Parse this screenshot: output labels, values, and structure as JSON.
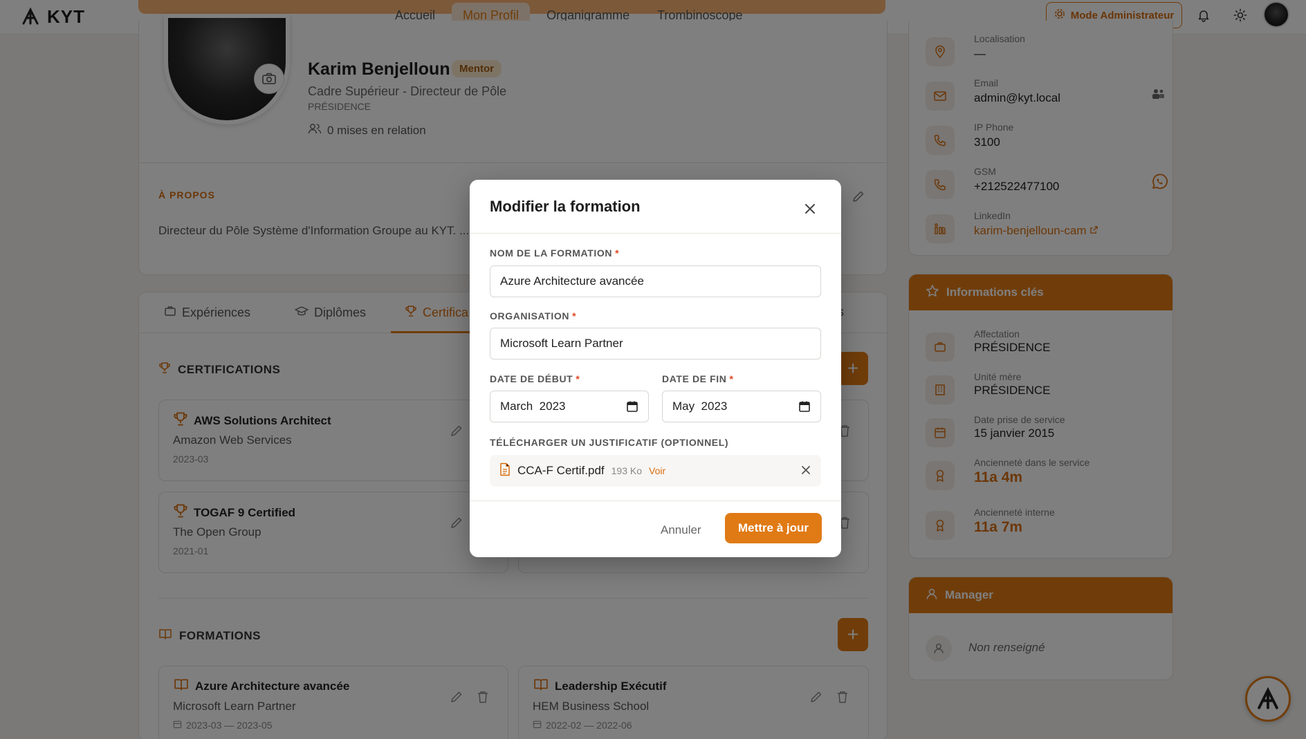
{
  "app": {
    "logo_text": "KYT"
  },
  "nav": {
    "items": [
      "Accueil",
      "Mon Profil",
      "Organigramme",
      "Trombinoscope"
    ],
    "active": "Mon Profil"
  },
  "header": {
    "admin_button": "Mode Administrateur",
    "icons": [
      "bell-icon",
      "sun-icon"
    ]
  },
  "profile": {
    "name": "Karim Benjelloun",
    "badge": "Mentor",
    "title": "Cadre Supérieur - Directeur de Pôle",
    "department": "PRÉSIDENCE",
    "relations": "0 mises en relation",
    "about_heading": "À PROPOS",
    "about_text": "Directeur du Pôle Système d'Information Groupe au KYT. ... et la gouvernance IT, il pilote la modernisation du SI et l'adopt..."
  },
  "tabs": {
    "items": [
      "Expériences",
      "Diplômes",
      "Certifica"
    ],
    "active": "Certifica",
    "trailing": "és"
  },
  "certifications": {
    "heading": "CERTIFICATIONS",
    "items": [
      {
        "title": "AWS Solutions Architect",
        "org": "Amazon Web Services",
        "date": "2023-03"
      },
      {
        "title": "TOGAF 9 Certified",
        "org": "The Open Group",
        "date": "2021-01"
      }
    ]
  },
  "formations": {
    "heading": "FORMATIONS",
    "items": [
      {
        "title": "Azure Architecture avancée",
        "org": "Microsoft Learn Partner",
        "date": "2023-03 — 2023-05"
      },
      {
        "title": "Leadership Exécutif",
        "org": "HEM Business School",
        "date": "2022-02 — 2022-06"
      }
    ]
  },
  "contact": {
    "items": [
      {
        "label": "Localisation",
        "value": "—"
      },
      {
        "label": "Email",
        "value": "admin@kyt.local"
      },
      {
        "label": "IP Phone",
        "value": "3100"
      },
      {
        "label": "GSM",
        "value": "+212522477100"
      },
      {
        "label": "LinkedIn",
        "value": "karim-benjelloun-cam"
      }
    ]
  },
  "key_info": {
    "heading": "Informations clés",
    "items": [
      {
        "label": "Affectation",
        "value": "PRÉSIDENCE"
      },
      {
        "label": "Unité mère",
        "value": "PRÉSIDENCE"
      },
      {
        "label": "Date prise de service",
        "value": "15 janvier 2015"
      },
      {
        "label": "Ancienneté dans le service",
        "value": "11a 4m"
      },
      {
        "label": "Ancienneté interne",
        "value": "11a 7m"
      }
    ]
  },
  "manager": {
    "heading": "Manager",
    "value": "Non renseigné"
  },
  "modal": {
    "title": "Modifier la formation",
    "name_label": "NOM DE LA FORMATION",
    "name_value": "Azure Architecture avancée",
    "org_label": "ORGANISATION",
    "org_value": "Microsoft Learn Partner",
    "start_label": "DATE DE DÉBUT",
    "start_value": "March  2023",
    "end_label": "DATE DE FIN",
    "end_value": "May  2023",
    "upload_label": "TÉLÉCHARGER UN JUSTIFICATIF (OPTIONNEL)",
    "file_name": "CCA-F Certif.pdf",
    "file_size": "193 Ko",
    "file_view": "Voir",
    "required_mark": "*",
    "cancel": "Annuler",
    "submit": "Mettre à jour"
  },
  "colors": {
    "accent": "#e07a15",
    "accent_light": "#fbe5d1",
    "overlay": "rgba(0,0,0,0.5)"
  }
}
